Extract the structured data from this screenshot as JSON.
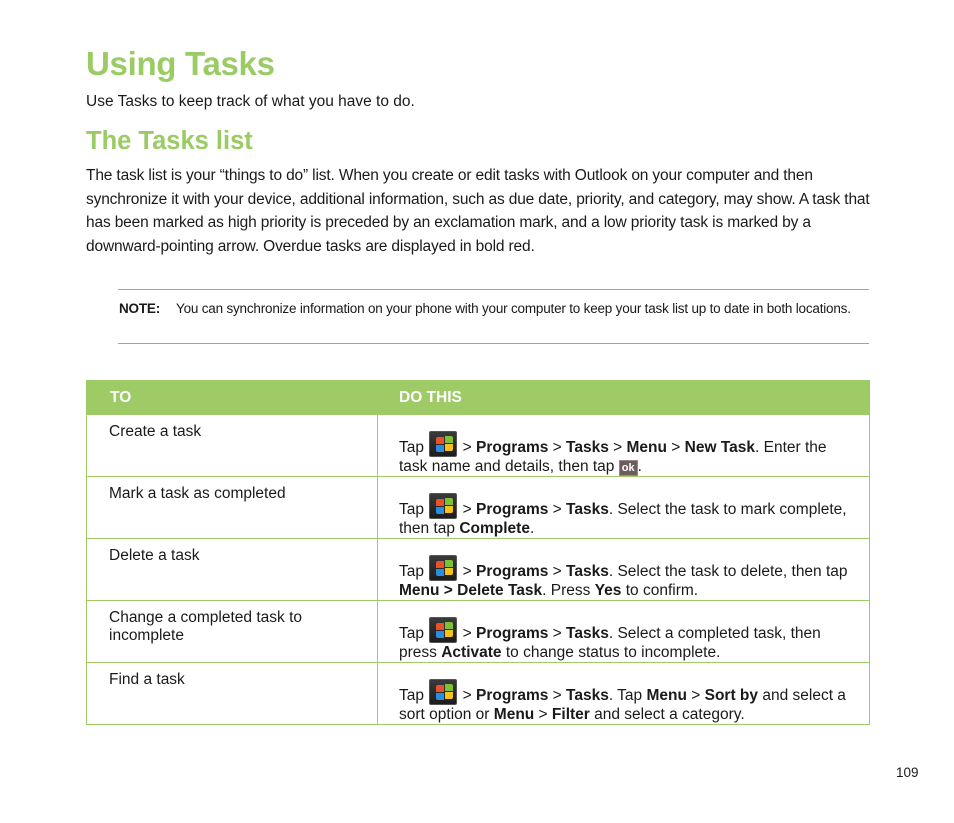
{
  "page": {
    "title": "Using Tasks",
    "intro": "Use Tasks to keep track of what you have to do.",
    "section_title": "The Tasks list",
    "paragraph": "The task list is your “things to do” list. When you create or edit tasks with Outlook on your computer and then synchronize it with your device, additional information, such as due date, priority, and category, may show. A task that has been marked as high priority is preceded by an exclamation mark, and a low priority task is marked by a downward-pointing arrow. Overdue tasks are displayed in bold red.",
    "note": {
      "label": "NOTE:",
      "text": "You can synchronize information on your phone with your computer to keep your task list up to date in both locations."
    },
    "page_number": "109"
  },
  "table": {
    "headers": [
      "TO",
      "DO THIS"
    ],
    "rows": [
      {
        "to": "Create a task",
        "do": [
          {
            "t": "Tap "
          },
          {
            "icon": "start"
          },
          {
            "t": " > "
          },
          {
            "b": "Programs"
          },
          {
            "t": " > "
          },
          {
            "b": "Tasks"
          },
          {
            "t": " > "
          },
          {
            "b": "Menu"
          },
          {
            "t": " > "
          },
          {
            "b": "New Task"
          },
          {
            "t": ". Enter the task name and details, then tap "
          },
          {
            "icon": "ok"
          },
          {
            "t": "."
          }
        ]
      },
      {
        "to": "Mark a task as completed",
        "do": [
          {
            "t": "Tap "
          },
          {
            "icon": "start"
          },
          {
            "t": " > "
          },
          {
            "b": "Programs"
          },
          {
            "t": " > "
          },
          {
            "b": "Tasks"
          },
          {
            "t": ". Select the task to mark complete, then tap "
          },
          {
            "b": "Complete"
          },
          {
            "t": "."
          }
        ]
      },
      {
        "to": "Delete a task",
        "do": [
          {
            "t": "Tap "
          },
          {
            "icon": "start"
          },
          {
            "t": " > "
          },
          {
            "b": "Programs"
          },
          {
            "t": " > "
          },
          {
            "b": "Tasks"
          },
          {
            "t": ". Select the task to delete, then tap "
          },
          {
            "b": "Menu > Delete Task"
          },
          {
            "t": ". Press "
          },
          {
            "b": "Yes"
          },
          {
            "t": " to confirm."
          }
        ]
      },
      {
        "to": "Change a completed task to incomplete",
        "do": [
          {
            "t": "Tap "
          },
          {
            "icon": "start"
          },
          {
            "t": " > "
          },
          {
            "b": "Programs"
          },
          {
            "t": " > "
          },
          {
            "b": "Tasks"
          },
          {
            "t": ". Select a completed task, then press "
          },
          {
            "b": "Activate"
          },
          {
            "t": " to change status to incomplete."
          }
        ]
      },
      {
        "to": "Find a task",
        "do": [
          {
            "t": "Tap "
          },
          {
            "icon": "start"
          },
          {
            "t": " > "
          },
          {
            "b": "Programs"
          },
          {
            "t": " > "
          },
          {
            "b": "Tasks"
          },
          {
            "t": ". Tap "
          },
          {
            "b": "Menu"
          },
          {
            "t": " > "
          },
          {
            "b": "Sort by"
          },
          {
            "t": " and select a sort option or "
          },
          {
            "b": "Menu"
          },
          {
            "t": " > "
          },
          {
            "b": "Filter"
          },
          {
            "t": " and select a category."
          }
        ]
      }
    ]
  },
  "icons": {
    "start": "windows-start-icon",
    "ok": "ok-button-icon",
    "ok_label": "ok"
  },
  "colors": {
    "accent": "#9acb64",
    "table_header": "#9fcb67",
    "text": "#1a1a1a"
  }
}
